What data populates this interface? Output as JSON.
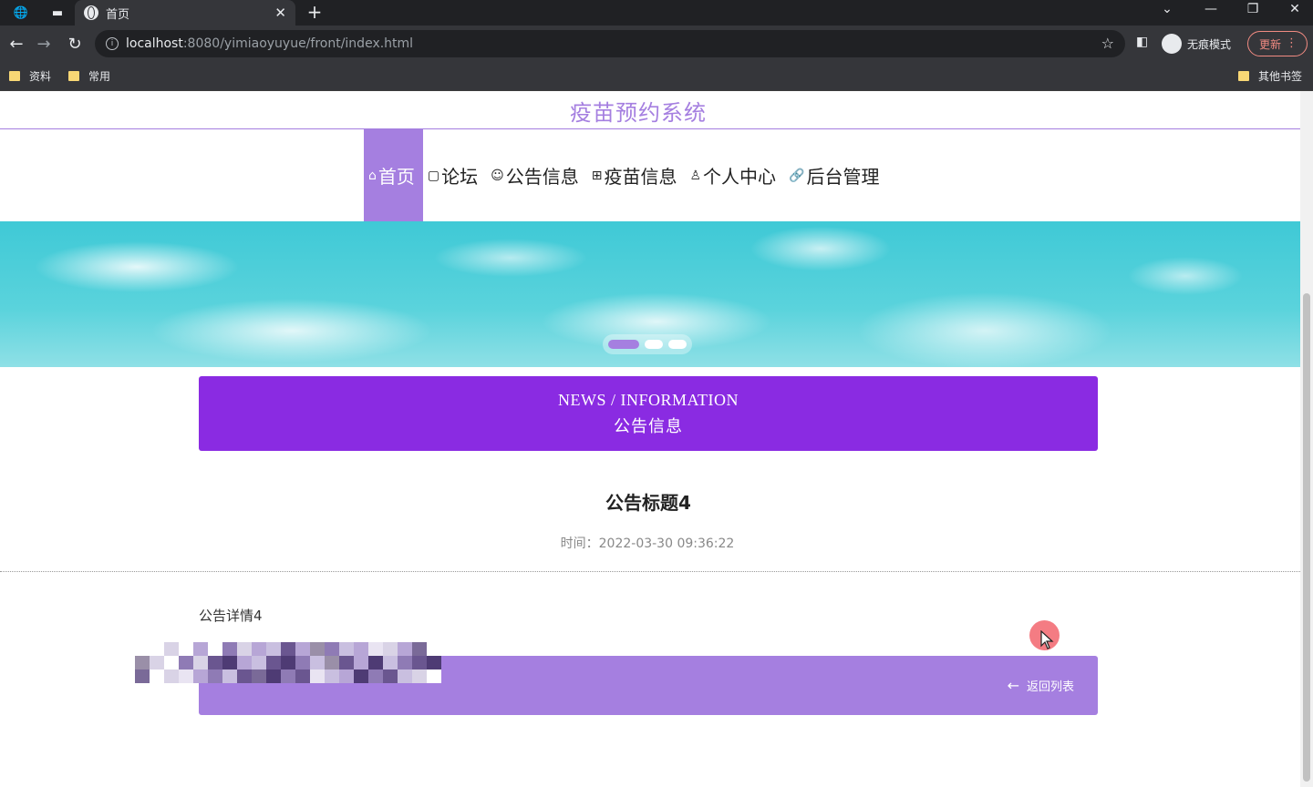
{
  "browser": {
    "tab_title": "首页",
    "url_host": "localhost",
    "url_rest": ":8080/yimiaoyuyue/front/index.html",
    "incognito_label": "无痕模式",
    "update_label": "更新",
    "bookmarks": [
      "资料",
      "常用"
    ],
    "other_bookmarks": "其他书签"
  },
  "site": {
    "title": "疫苗预约系统"
  },
  "nav": {
    "items": [
      {
        "icon": "home-icon",
        "label": "首页",
        "active": true
      },
      {
        "icon": "forum-icon",
        "label": "论坛",
        "active": false
      },
      {
        "icon": "notice-icon",
        "label": "公告信息",
        "active": false
      },
      {
        "icon": "vaccine-icon",
        "label": "疫苗信息",
        "active": false
      },
      {
        "icon": "user-icon",
        "label": "个人中心",
        "active": false
      },
      {
        "icon": "link-icon",
        "label": "后台管理",
        "active": false
      }
    ]
  },
  "banner": {
    "slide_count": 3,
    "active_slide": 1
  },
  "section": {
    "title_en": "NEWS / INFORMATION",
    "title_cn": "公告信息"
  },
  "notice": {
    "title": "公告标题4",
    "time": "时间：2022-03-30 09:36:22",
    "content": "公告详情4"
  },
  "actions": {
    "back_label": "返回列表"
  },
  "colors": {
    "accent": "#a57fe0",
    "header_purple": "#8a2be2"
  }
}
